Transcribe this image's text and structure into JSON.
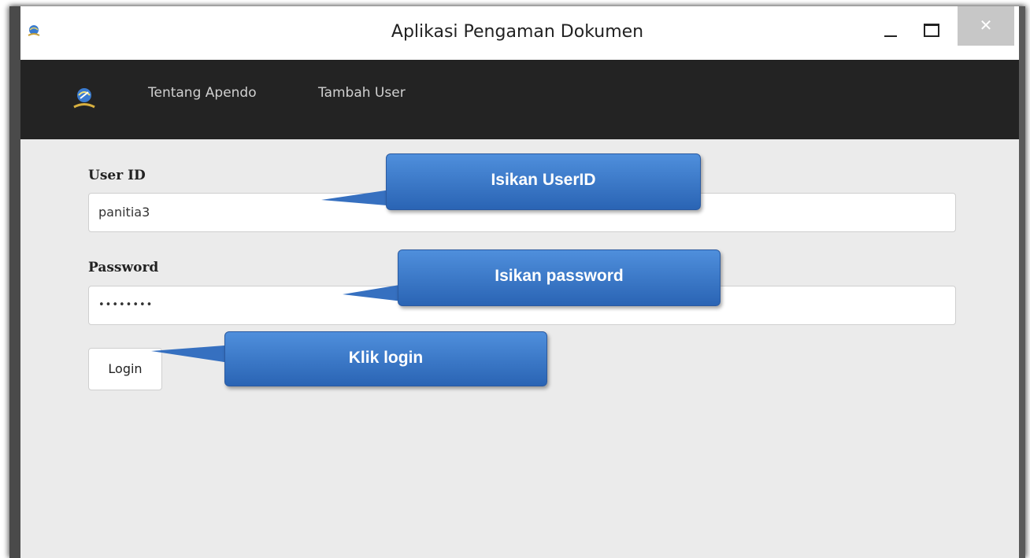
{
  "window": {
    "title": "Aplikasi Pengaman Dokumen",
    "close_glyph": "✕"
  },
  "navbar": {
    "items": [
      {
        "label": "Tentang Apendo"
      },
      {
        "label": "Tambah User"
      }
    ]
  },
  "form": {
    "userid_label": "User ID",
    "userid_value": "panitia3",
    "password_label": "Password",
    "password_value": "••••••••",
    "login_label": "Login"
  },
  "callouts": {
    "userid": "Isikan UserID",
    "password": "Isikan password",
    "login": "Klik login"
  },
  "colors": {
    "navbar_bg": "#232323",
    "callout_blue": "#3b78c8",
    "close_button_bg": "#c7c7c7"
  },
  "icons": {
    "app": "globe-emblem-icon",
    "nav_logo": "globe-emblem-icon"
  }
}
